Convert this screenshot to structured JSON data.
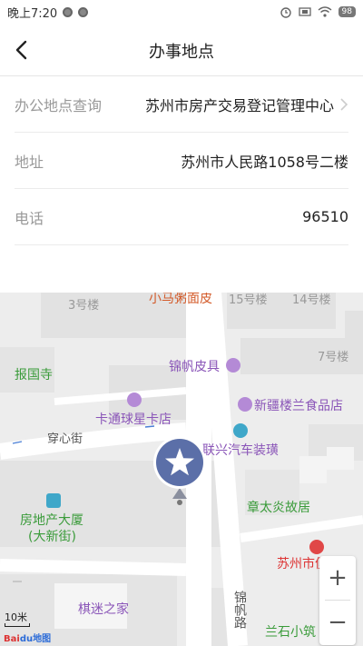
{
  "status_bar": {
    "time": "晚上7:20",
    "battery": "98"
  },
  "nav": {
    "title": "办事地点",
    "back_icon": "chevron-left-icon"
  },
  "rows": [
    {
      "label": "办公地点查询",
      "value": "苏州市房产交易登记管理中心",
      "has_chevron": true
    },
    {
      "label": "地址",
      "value": "苏州市人民路1058号二楼",
      "has_chevron": false
    },
    {
      "label": "电话",
      "value": "96510",
      "has_chevron": false
    }
  ],
  "map": {
    "pois": {
      "bldg_3": "3号楼",
      "xiaomajiang": "小马粥面皮",
      "bldg_15": "15号楼",
      "bldg_14": "14号楼",
      "bldg_7": "7号楼",
      "baoguosi": "报国寺",
      "jinfan_leather": "锦帆皮具",
      "xinjiang_food": "新疆楼兰食品店",
      "katong_card": "卡通球星卡店",
      "chuanxin_street": "穿心街",
      "lianxing_auto": "联兴汽车装璜",
      "zhangtaiyan": "章太炎故居",
      "real_estate_line1": "房地产大厦",
      "real_estate_line2": "(大新街)",
      "suzhou_service": "苏州市便务中",
      "qimi_home": "棋迷之家",
      "jinfan_road": "锦帆路",
      "lanshi": "兰石小筑"
    },
    "zoom_in": "+",
    "zoom_out": "−",
    "scale_label": "10米",
    "logo_part1": "Bai",
    "logo_part2": "du地图",
    "pin_icon": "star-location-pin-icon"
  }
}
